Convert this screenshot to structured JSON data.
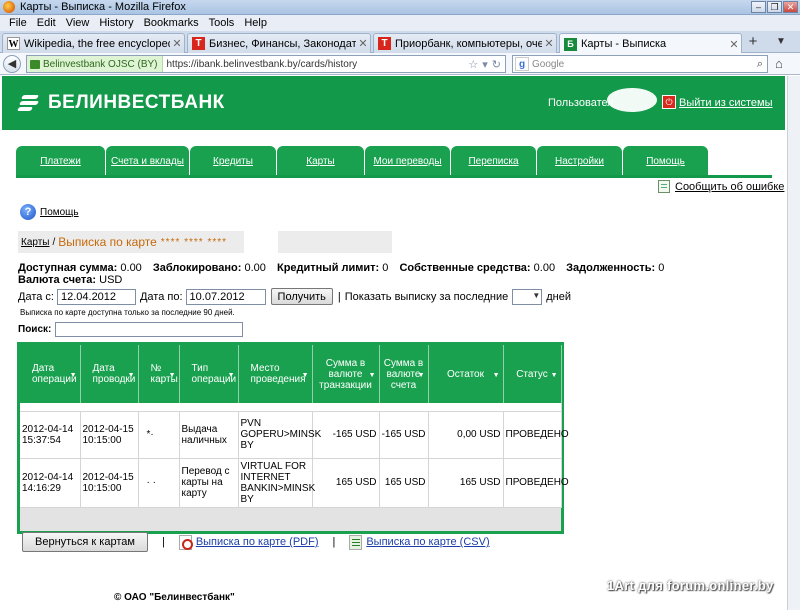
{
  "window": {
    "title": "Карты - Выписка - Mozilla Firefox"
  },
  "menu": [
    "File",
    "Edit",
    "View",
    "History",
    "Bookmarks",
    "Tools",
    "Help"
  ],
  "tabs": [
    {
      "label": "Wikipedia, the free encyclopedia",
      "favicon": "W"
    },
    {
      "label": "Бизнес, Финансы, Законодательство и...",
      "favicon": "T"
    },
    {
      "label": "Приорбанк, компьютеры, очереди, пл...",
      "favicon": "T"
    },
    {
      "label": "Карты - Выписка",
      "favicon": "Б"
    }
  ],
  "navbar": {
    "identity": "Belinvestbank OJSC (BY)",
    "url": "https://ibank.belinvestbank.by/cards/history",
    "search_placeholder": "Google"
  },
  "header": {
    "bank_name": "БЕЛИНВЕСТБАНК",
    "user_label": "Пользовател",
    "logout": "Выйти из системы"
  },
  "nav": [
    "Платежи",
    "Счета и вклады",
    "Кредиты",
    "Карты",
    "Мои переводы",
    "Переписка",
    "Настройки",
    "Помощь"
  ],
  "report_error": "Сообщить об ошибке",
  "help": "Помощь",
  "breadcrumb": {
    "parent": "Карты",
    "separator": "/",
    "current": "Выписка по карте",
    "mask": "**** **** ****"
  },
  "summary": {
    "available_label": "Доступная сумма:",
    "available": "0.00",
    "blocked_label": "Заблокировано:",
    "blocked": "0.00",
    "credit_label": "Кредитный лимит:",
    "credit": "0",
    "own_label": "Собственные средства:",
    "own": "0.00",
    "debt_label": "Задолженность:",
    "debt": "0",
    "currency_label": "Валюта счета:",
    "currency": "USD"
  },
  "filters": {
    "date_from_label": "Дата с:",
    "date_from": "12.04.2012",
    "date_to_label": "Дата по:",
    "date_to": "10.07.2012",
    "submit": "Получить",
    "separator": "|",
    "last_label": "Показать выписку за последние",
    "days_label": "дней"
  },
  "note": "Выписка по карте доступна только за последние 90 дней.",
  "search_label": "Поиск:",
  "table": {
    "headers": [
      "Дата операции",
      "Дата проводки",
      "№ карты",
      "Тип операции",
      "Место проведения",
      "Сумма в валюте транзакции",
      "Сумма в валюте счета",
      "Остаток",
      "Статус"
    ],
    "rows": [
      [
        "2012-04-14 15:37:54",
        "2012-04-15 10:15:00",
        "*·",
        "Выдача наличных",
        "PVN GOPERU>MINSK BY",
        "-165 USD",
        "-165 USD",
        "0,00 USD",
        "ПРОВЕДЕНО"
      ],
      [
        "2012-04-14 14:16:29",
        "2012-04-15 10:15:00",
        "· ·",
        "Перевод с карты на карту",
        "VIRTUAL FOR INTERNET BANKIN>MINSK BY",
        "165 USD",
        "165 USD",
        "165 USD",
        "ПРОВЕДЕНО"
      ]
    ]
  },
  "actions": {
    "back": "Вернуться к картам",
    "separator": "|",
    "pdf": "Выписка по карте (PDF)",
    "csv": "Выписка по карте (CSV)"
  },
  "footer": "© ОАО \"Белинвестбанк\"",
  "watermark": "1Art для forum.onliner.by",
  "colors": {
    "brand_green": "#12994a",
    "tab_green": "#1aa14f",
    "crumb_orange": "#c56a0a"
  }
}
